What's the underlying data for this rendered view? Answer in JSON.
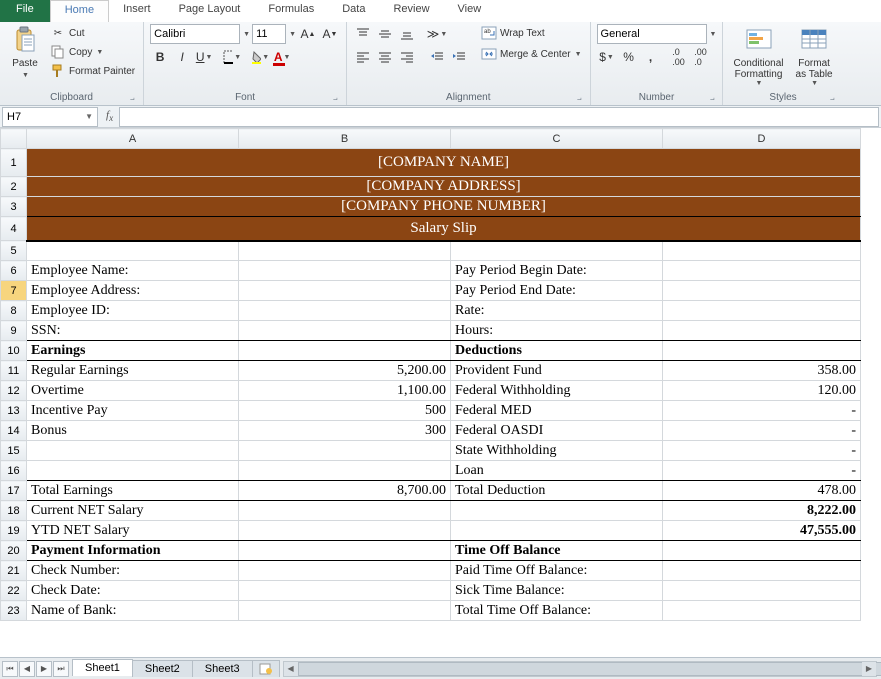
{
  "tabs": {
    "file": "File",
    "home": "Home",
    "insert": "Insert",
    "pageLayout": "Page Layout",
    "formulas": "Formulas",
    "data": "Data",
    "review": "Review",
    "view": "View"
  },
  "clipboard": {
    "paste": "Paste",
    "cut": "Cut",
    "copy": "Copy",
    "formatPainter": "Format Painter",
    "label": "Clipboard"
  },
  "font": {
    "name": "Calibri",
    "size": "11",
    "label": "Font"
  },
  "alignment": {
    "wrap": "Wrap Text",
    "merge": "Merge & Center",
    "label": "Alignment"
  },
  "number": {
    "format": "General",
    "label": "Number"
  },
  "styles": {
    "cond": "Conditional\nFormatting",
    "table": "Format\nas Table",
    "label": "Styles"
  },
  "nameBox": "H7",
  "colHeaders": [
    "A",
    "B",
    "C",
    "D"
  ],
  "rows": {
    "1": {
      "merged": "[COMPANY NAME]"
    },
    "2": {
      "merged": "[COMPANY ADDRESS]"
    },
    "3": {
      "merged": "[COMPANY PHONE NUMBER]"
    },
    "4": {
      "merged": "Salary Slip"
    },
    "6": {
      "A": "Employee Name:",
      "C": "Pay Period Begin Date:"
    },
    "7": {
      "A": "Employee Address:",
      "C": "Pay Period End Date:"
    },
    "8": {
      "A": "Employee ID:",
      "C": "Rate:"
    },
    "9": {
      "A": "SSN:",
      "C": "Hours:"
    },
    "10": {
      "A": "Earnings",
      "C": "Deductions"
    },
    "11": {
      "A": "Regular Earnings",
      "B": "5,200.00",
      "C": "Provident Fund",
      "D": "358.00"
    },
    "12": {
      "A": "Overtime",
      "B": "1,100.00",
      "C": "Federal Withholding",
      "D": "120.00"
    },
    "13": {
      "A": "Incentive Pay",
      "B": "500",
      "C": "Federal MED",
      "D": "-"
    },
    "14": {
      "A": "Bonus",
      "B": "300",
      "C": "Federal OASDI",
      "D": "-"
    },
    "15": {
      "C": "State Withholding",
      "D": "-"
    },
    "16": {
      "C": "Loan",
      "D": "-"
    },
    "17": {
      "A": "Total Earnings",
      "B": "8,700.00",
      "C": "Total Deduction",
      "D": "478.00"
    },
    "18": {
      "A": "Current NET Salary",
      "D": "8,222.00"
    },
    "19": {
      "A": "YTD NET Salary",
      "D": "47,555.00"
    },
    "20": {
      "A": "Payment Information",
      "C": "Time Off Balance"
    },
    "21": {
      "A": "Check  Number:",
      "C": "Paid Time Off Balance:"
    },
    "22": {
      "A": "Check Date:",
      "C": "Sick Time Balance:"
    },
    "23": {
      "A": "Name of Bank:",
      "C": "Total Time Off Balance:"
    }
  },
  "sheets": {
    "s1": "Sheet1",
    "s2": "Sheet2",
    "s3": "Sheet3"
  }
}
